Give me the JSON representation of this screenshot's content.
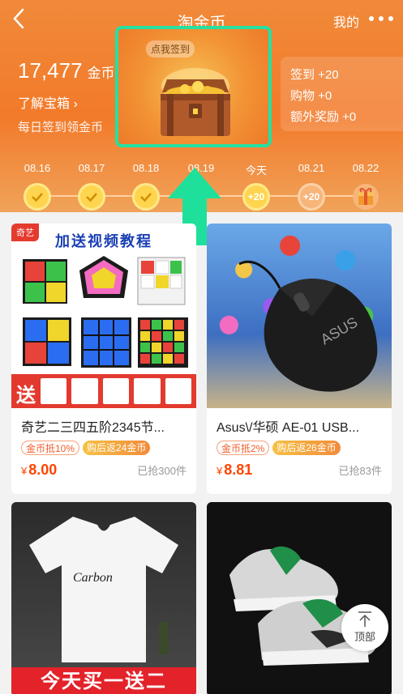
{
  "nav": {
    "title": "淘金币",
    "mine": "我的"
  },
  "account": {
    "coins": "17,477",
    "coins_unit": "金币",
    "learn": "了解宝箱",
    "daily": "每日签到领金币"
  },
  "chest": {
    "badge": "点我签到"
  },
  "rewards": [
    "签到 +20",
    "购物 +0",
    "额外奖励 +0"
  ],
  "days": [
    {
      "label": "08.16",
      "state": "done",
      "text": ""
    },
    {
      "label": "08.17",
      "state": "done",
      "text": ""
    },
    {
      "label": "08.18",
      "state": "done",
      "text": ""
    },
    {
      "label": "08.19",
      "state": "future",
      "text": ""
    },
    {
      "label": "今天",
      "state": "today",
      "text": "+20"
    },
    {
      "label": "08.21",
      "state": "future",
      "text": "+20"
    },
    {
      "label": "08.22",
      "state": "gift",
      "text": ""
    }
  ],
  "products": [
    {
      "title": "奇艺二三四五阶2345节...",
      "tag_coin": "金币抵10%",
      "tag_back": "购后返24金币",
      "price_symbol": "¥",
      "price": "8.00",
      "sold": "已抢300件",
      "img_banner": "加送视频教程",
      "img_corner": "奇艺",
      "img_bottom": "送"
    },
    {
      "title": "Asus\\/华硕 AE-01 USB...",
      "tag_coin": "金币抵2%",
      "tag_back": "购后返26金币",
      "price_symbol": "¥",
      "price": "8.81",
      "sold": "已抢83件",
      "img_brand": "ASUS"
    },
    {
      "img_banner": "今天买一送二",
      "img_shirt_text": "Carbon"
    },
    {}
  ],
  "top_button": {
    "label": "顶部"
  },
  "colors": {
    "accent": "#f27a2a",
    "price": "#ff4400",
    "highlight": "#25e0a0"
  }
}
